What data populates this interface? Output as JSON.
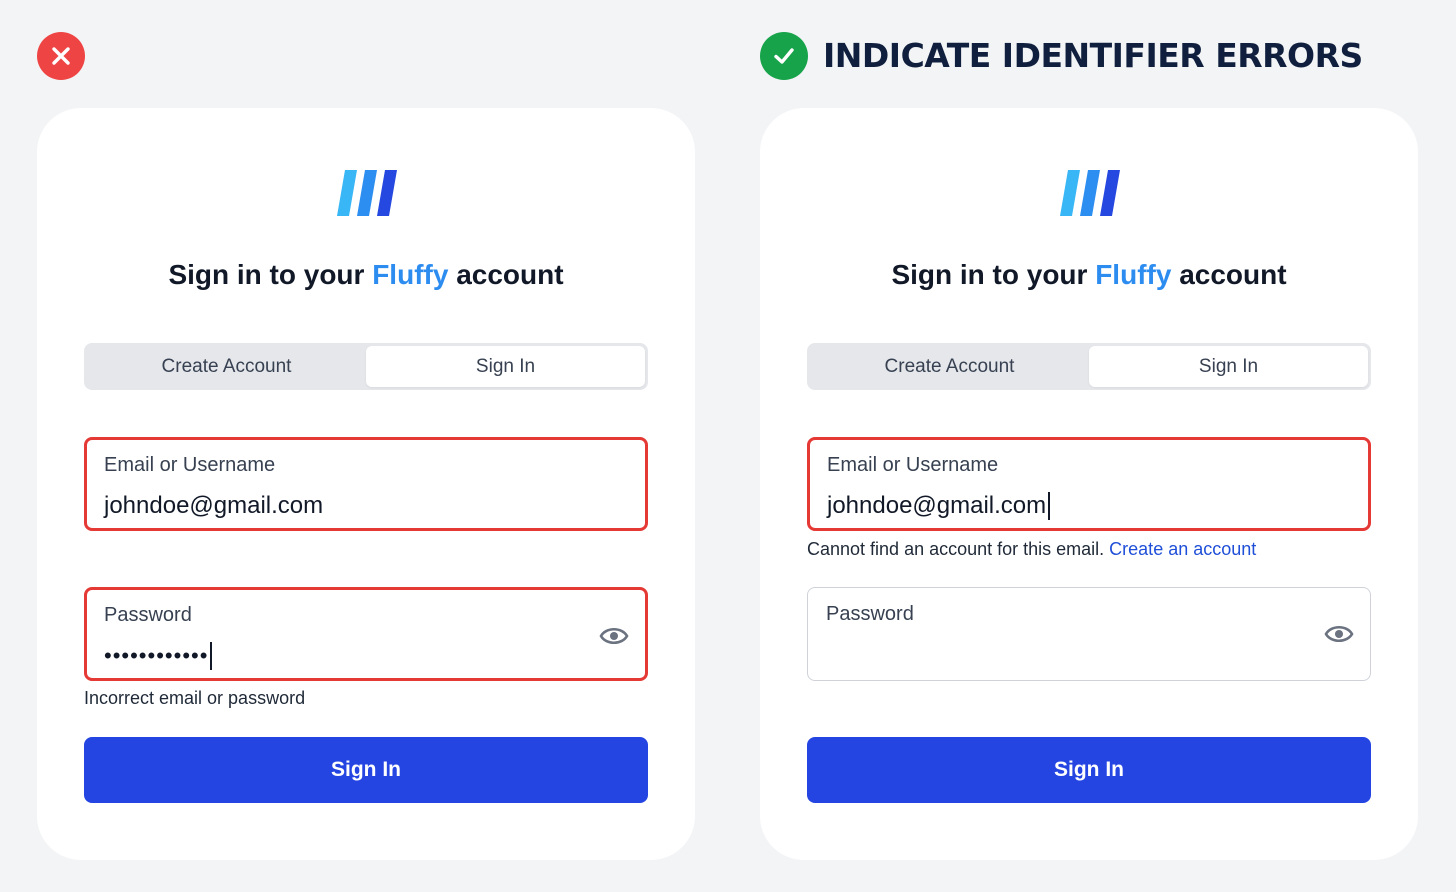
{
  "heading": {
    "good_title": "INDICATE IDENTIFIER ERRORS"
  },
  "colors": {
    "bad": "#ef4444",
    "good": "#16a34a",
    "brand": "#2d8cf0",
    "primary_button": "#2545e3",
    "error_border": "#e53935",
    "link": "#1f4fd8"
  },
  "cards": {
    "bad": {
      "title_prefix": "Sign in to your ",
      "title_brand": "Fluffy",
      "title_suffix": " account",
      "tabs": {
        "create": "Create Account",
        "signin": "Sign In"
      },
      "email": {
        "label": "Email or Username",
        "value": "johndoe@gmail.com"
      },
      "password": {
        "label": "Password",
        "value": "••••••••••••"
      },
      "error_message": "Incorrect email or password",
      "button": "Sign In"
    },
    "good": {
      "title_prefix": "Sign in to your ",
      "title_brand": "Fluffy",
      "title_suffix": " account",
      "tabs": {
        "create": "Create Account",
        "signin": "Sign In"
      },
      "email": {
        "label": "Email or Username",
        "value": "johndoe@gmail.com"
      },
      "error_message": "Cannot find an account for this email. ",
      "error_link": "Create an account",
      "password": {
        "label": "Password",
        "value": ""
      },
      "button": "Sign In"
    }
  },
  "icons": {
    "bad_badge": "close-icon",
    "good_badge": "check-icon",
    "logo": "fluffy-logo-icon",
    "show_password": "eye-icon"
  }
}
